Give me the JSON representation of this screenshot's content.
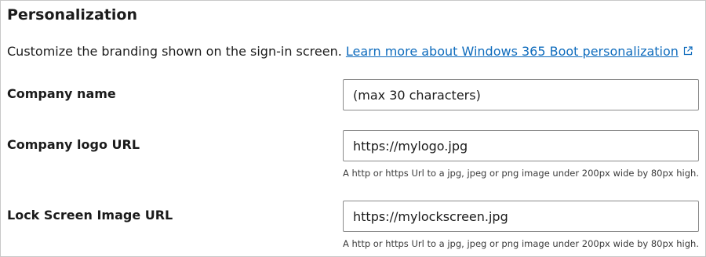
{
  "section": {
    "title": "Personalization",
    "description": "Customize the branding shown on the sign-in screen.",
    "link_label": "Learn more about Windows 365 Boot personalization",
    "link_icon": "external-link-icon"
  },
  "fields": {
    "company_name": {
      "label": "Company name",
      "value": "",
      "placeholder": "(max 30 characters)"
    },
    "company_logo": {
      "label": "Company logo URL",
      "value": "https://mylogo.jpg",
      "hint": "A http or https Url to a jpg, jpeg or png image under 200px wide by 80px high."
    },
    "lock_screen": {
      "label": "Lock Screen Image URL",
      "value": "https://mylockscreen.jpg",
      "hint": "A http or https Url to a jpg, jpeg or png image under 200px wide by 80px high."
    }
  },
  "colors": {
    "link": "#0f6cbd",
    "text": "#1b1b1b",
    "input_border": "#8a8a8a"
  }
}
